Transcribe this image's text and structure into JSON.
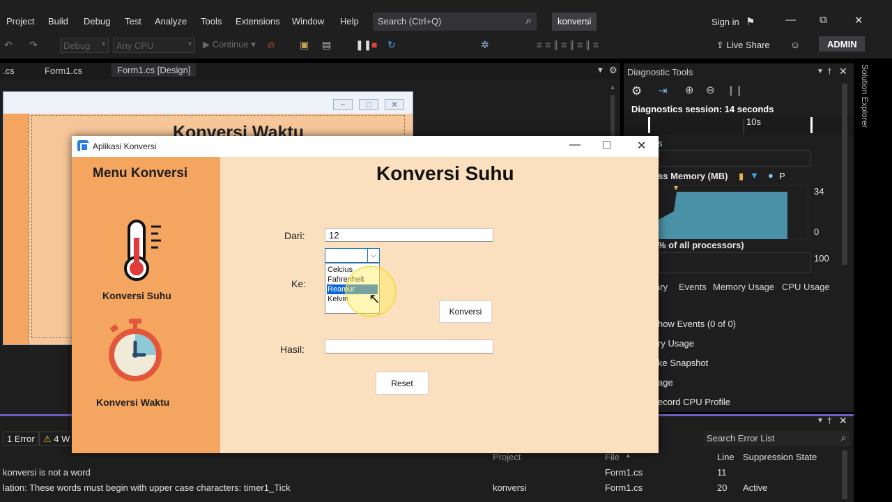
{
  "menubar": {
    "items": [
      "Project",
      "Build",
      "Debug",
      "Test",
      "Analyze",
      "Tools",
      "Extensions",
      "Window",
      "Help"
    ],
    "search_placeholder": "Search (Ctrl+Q)",
    "project_name": "konversi",
    "sign_in": "Sign in"
  },
  "toolbar": {
    "config": "Debug",
    "platform": "Any CPU",
    "continue_label": "Continue",
    "live_share": "Live Share",
    "user": "ADMIN"
  },
  "doc_tabs": [
    ".cs",
    "Form1.cs",
    "Form1.cs [Design]"
  ],
  "designer": {
    "form_title": "Konversi Waktu"
  },
  "diagnostics": {
    "title": "Diagnostic Tools",
    "session": "Diagnostics session: 14 seconds",
    "time_tick": "10s",
    "events_fragment": "s",
    "memory_label": "ss Memory (MB)",
    "memory_legend": "P",
    "memory_max": "34",
    "memory_min": "0",
    "cpu_label": "% of all processors)",
    "cpu_max": "100",
    "tabs": [
      "ary",
      "Events",
      "Memory Usage",
      "CPU Usage"
    ],
    "list": [
      "how Events (0 of 0)",
      "ry Usage",
      "ke Snapshot",
      "age",
      "ecord CPU Profile"
    ],
    "side_label": "Solution Explorer"
  },
  "error_list": {
    "errors_chip": "1 Error",
    "warnings_chip": "4 W",
    "search_placeholder": "Search Error List",
    "columns": [
      "Project",
      "File",
      "Line",
      "Suppression State"
    ],
    "rows": [
      {
        "description": "konversi is not a word",
        "project": "",
        "file": "Form1.cs",
        "line": "11",
        "state": ""
      },
      {
        "description": "lation: These words must begin with upper case characters: timer1_Tick",
        "project": "konversi",
        "file": "Form1.cs",
        "line": "20",
        "state": "Active"
      }
    ]
  },
  "app": {
    "title": "Aplikasi Konversi",
    "side_heading": "Menu Konversi",
    "menu_suhu": "Konversi Suhu",
    "menu_waktu": "Konversi Waktu",
    "main_title": "Konversi Suhu",
    "dari_label": "Dari:",
    "dari_value": "12",
    "ke_label": "Ke:",
    "hasil_label": "Hasil:",
    "hasil_value": "",
    "combo_value": "",
    "options": [
      "Celcius",
      "Fahrenheit",
      "Reamur",
      "Kelvin"
    ],
    "selected_option": "Reamur",
    "konversi_button": "Konversi",
    "reset_button": "Reset"
  }
}
